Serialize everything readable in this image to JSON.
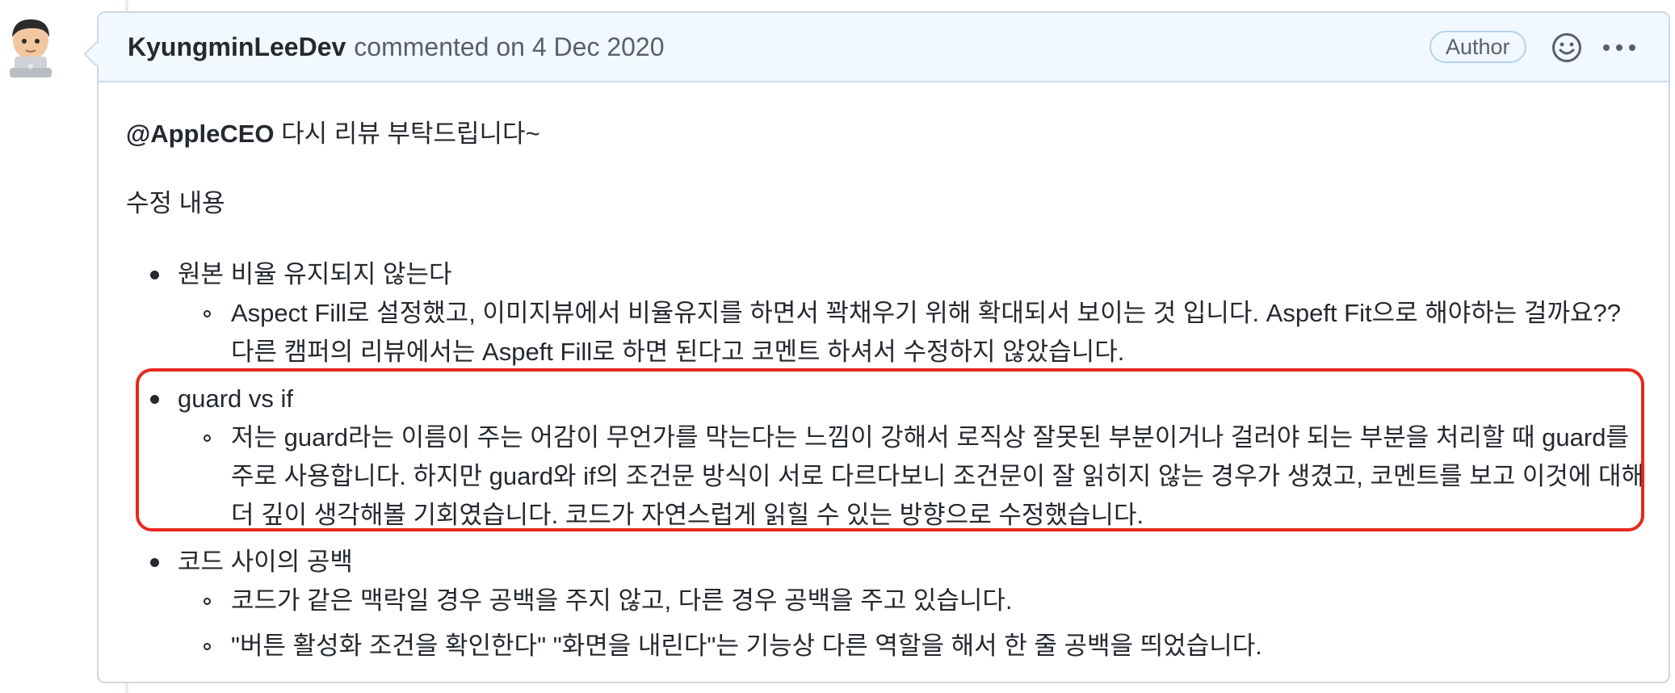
{
  "comment": {
    "author": "KyungminLeeDev",
    "meta": "commented on 4 Dec 2020",
    "badge": "Author",
    "mention": "@AppleCEO",
    "greeting": " 다시 리뷰 부탁드립니다~",
    "section_title": "수정 내용",
    "items": [
      {
        "label": "원본 비율 유지되지 않는다",
        "subs": [
          "Aspect Fill로 설정했고, 이미지뷰에서 비율유지를 하면서 꽉채우기 위해 확대되서 보이는 것 입니다. Aspeft Fit으로 해야하는 걸까요?? 다른 캠퍼의 리뷰에서는 Aspeft Fill로 하면 된다고 코멘트 하셔서 수정하지 않았습니다."
        ]
      },
      {
        "label": "guard vs if",
        "subs": [
          "저는 guard라는 이름이 주는 어감이 무언가를 막는다는 느낌이 강해서 로직상 잘못된 부분이거나 걸러야 되는 부분을 처리할 때 guard를 주로 사용합니다. 하지만 guard와 if의 조건문 방식이 서로 다르다보니 조건문이 잘 읽히지 않는 경우가 생겼고, 코멘트를 보고 이것에 대해 더 깊이 생각해볼 기회였습니다. 코드가 자연스럽게 읽힐 수 있는 방향으로 수정했습니다."
        ]
      },
      {
        "label": "코드 사이의 공백",
        "subs": [
          "코드가 같은 맥락일 경우 공백을 주지 않고, 다른 경우 공백을 주고 있습니다.",
          "\"버튼 활성화 조건을 확인한다\" \"화면을 내린다\"는 기능상 다른 역할을 해서 한 줄 공백을 띄었습니다."
        ]
      }
    ]
  },
  "icons": {
    "avatar": "memoji-avatar-icon",
    "reaction": "smiley-icon",
    "more": "kebab-horizontal-icon"
  },
  "colors": {
    "header_bg": "#f1f8ff",
    "highlight_border": "#e8271e"
  }
}
